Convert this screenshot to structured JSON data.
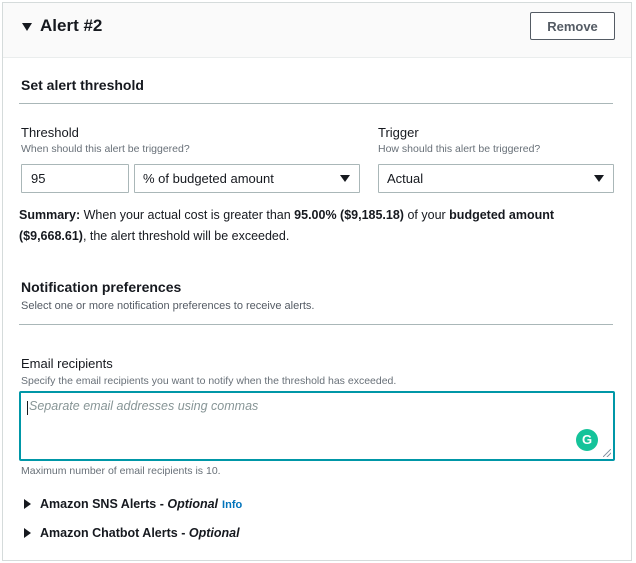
{
  "header": {
    "title": "Alert #2",
    "remove_label": "Remove"
  },
  "threshold_section": {
    "title": "Set alert threshold",
    "threshold_label": "Threshold",
    "threshold_desc": "When should this alert be triggered?",
    "threshold_value": "95",
    "unit_selected": "% of budgeted amount",
    "trigger_label": "Trigger",
    "trigger_desc": "How should this alert be triggered?",
    "trigger_selected": "Actual"
  },
  "summary": {
    "label": "Summary:",
    "text1": "When your actual cost is greater than",
    "percent_amount": "95.00% ($9,185.18)",
    "text2": "of your",
    "budget_label": "budgeted amount",
    "budget_value": "($9,668.61)",
    "text3": ", the alert threshold will be exceeded."
  },
  "notification": {
    "title": "Notification preferences",
    "desc": "Select one or more notification preferences to receive alerts."
  },
  "email": {
    "label": "Email recipients",
    "desc": "Specify the email recipients you want to notify when the threshold has exceeded.",
    "placeholder": "Separate email addresses using commas",
    "grammarly_glyph": "G",
    "max_note": "Maximum number of email recipients is 10."
  },
  "expanders": {
    "sns_label": "Amazon SNS Alerts - ",
    "sns_optional": "Optional",
    "sns_info": "Info",
    "chatbot_label": "Amazon Chatbot Alerts - ",
    "chatbot_optional": "Optional"
  },
  "colors": {
    "focus_border": "#0097a7",
    "grammarly": "#15c39a",
    "info_link": "#0073bb"
  },
  "icons": {
    "collapse": "caret-down-icon",
    "expand": "caret-right-icon",
    "select": "select-arrow-icon",
    "grammarly": "grammarly-icon"
  }
}
